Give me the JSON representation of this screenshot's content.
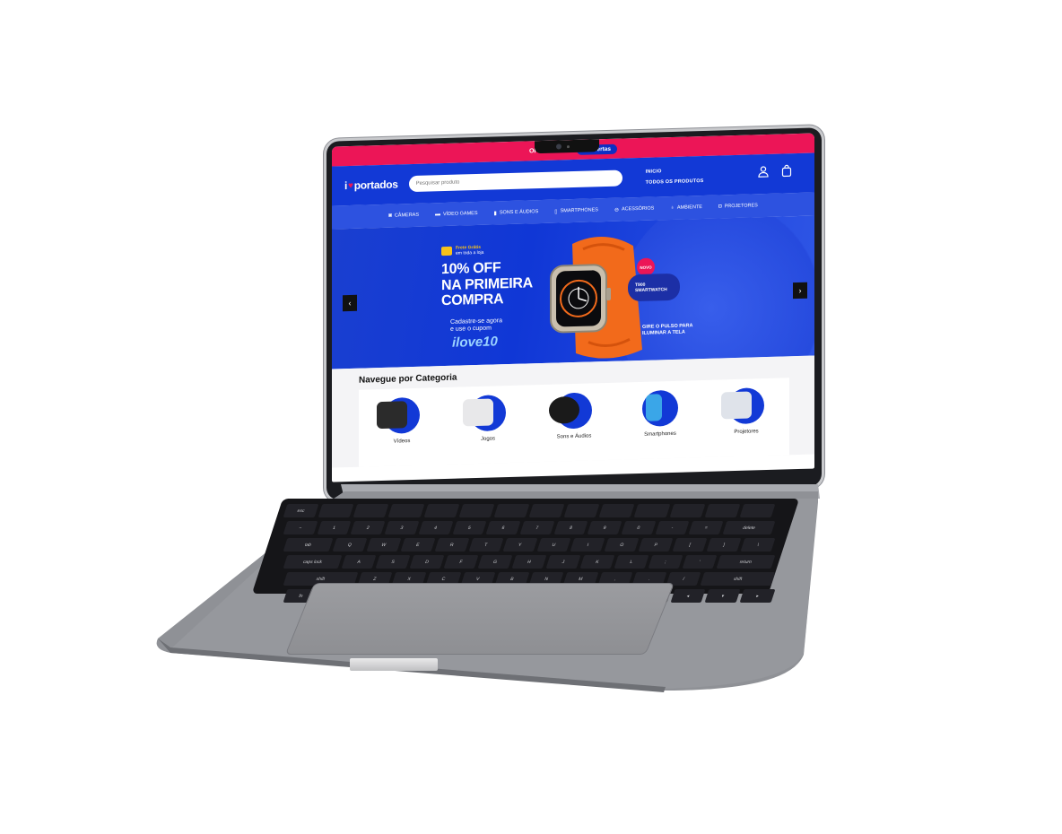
{
  "promo_bar": {
    "text": "OFERTAS CO",
    "button": "er Ofertas"
  },
  "header": {
    "logo_prefix": "i",
    "logo_suffix": "portados",
    "search_placeholder": "Pesquisar produto",
    "nav_links": [
      "INICIO",
      "TODOS OS PRODUTOS"
    ]
  },
  "category_bar": {
    "items": [
      {
        "label": "CÂMERAS",
        "icon": "camera-icon",
        "glyph": "◙"
      },
      {
        "label": "VÍDEO GAMES",
        "icon": "gamepad-icon",
        "glyph": "▬"
      },
      {
        "label": "SONS E ÁUDIOS",
        "icon": "speaker-icon",
        "glyph": "▮"
      },
      {
        "label": "SMARTPHONES",
        "icon": "phone-icon",
        "glyph": "▯"
      },
      {
        "label": "ACESSÓRIOS",
        "icon": "accessory-icon",
        "glyph": "⊖"
      },
      {
        "label": "AMBIENTE",
        "icon": "lamp-icon",
        "glyph": "♁"
      },
      {
        "label": "PROJETORES",
        "icon": "projector-icon",
        "glyph": "◘"
      }
    ]
  },
  "banner": {
    "frete_line1": "Frete Grátis",
    "frete_line2": "em toda a loja",
    "headline_1": "10% OFF",
    "headline_2": "NA PRIMEIRA",
    "headline_3": "COMPRA",
    "sub_1": "Cadastre-se agora",
    "sub_2": "e use o cupom",
    "coupon": "ilove10",
    "badge_new": "NOVO",
    "product_line1": "T900",
    "product_line2": "SMARTWATCH",
    "tagline_1": "GIRE O PULSO PARA",
    "tagline_2": "ILUMINAR A TELA",
    "prev": "‹",
    "next": "›"
  },
  "categories": {
    "title": "Navegue por Categoria",
    "items": [
      {
        "label": "Vídeos",
        "color": "#2b2b2b"
      },
      {
        "label": "Jogos",
        "color": "#e8e8ea"
      },
      {
        "label": "Sons e Áudios",
        "color": "#1a1a1a"
      },
      {
        "label": "Smartphones",
        "color": "#3aa6e8"
      },
      {
        "label": "Projetores",
        "color": "#dfe3ea"
      }
    ]
  },
  "keyboard": {
    "row1": [
      "esc",
      "",
      "",
      "",
      "",
      "",
      "",
      "",
      "",
      "",
      "",
      "",
      "",
      ""
    ],
    "row2": [
      "~",
      "1",
      "2",
      "3",
      "4",
      "5",
      "6",
      "7",
      "8",
      "9",
      "0",
      "-",
      "=",
      "delete"
    ],
    "row3": [
      "tab",
      "Q",
      "W",
      "E",
      "R",
      "T",
      "Y",
      "U",
      "I",
      "O",
      "P",
      "[",
      "]",
      "\\"
    ],
    "row4": [
      "caps lock",
      "A",
      "S",
      "D",
      "F",
      "G",
      "H",
      "J",
      "K",
      "L",
      ";",
      "'",
      "return"
    ],
    "row5": [
      "shift",
      "Z",
      "X",
      "C",
      "V",
      "B",
      "N",
      "M",
      ",",
      ".",
      "/",
      "shift"
    ],
    "row6": [
      "fn",
      "control",
      "option",
      "command",
      "",
      "command",
      "option",
      "◂",
      "▾",
      "▸"
    ]
  },
  "colors": {
    "primary": "#1239d6",
    "accent": "#ec1557",
    "coupon": "#9bd3ff"
  }
}
